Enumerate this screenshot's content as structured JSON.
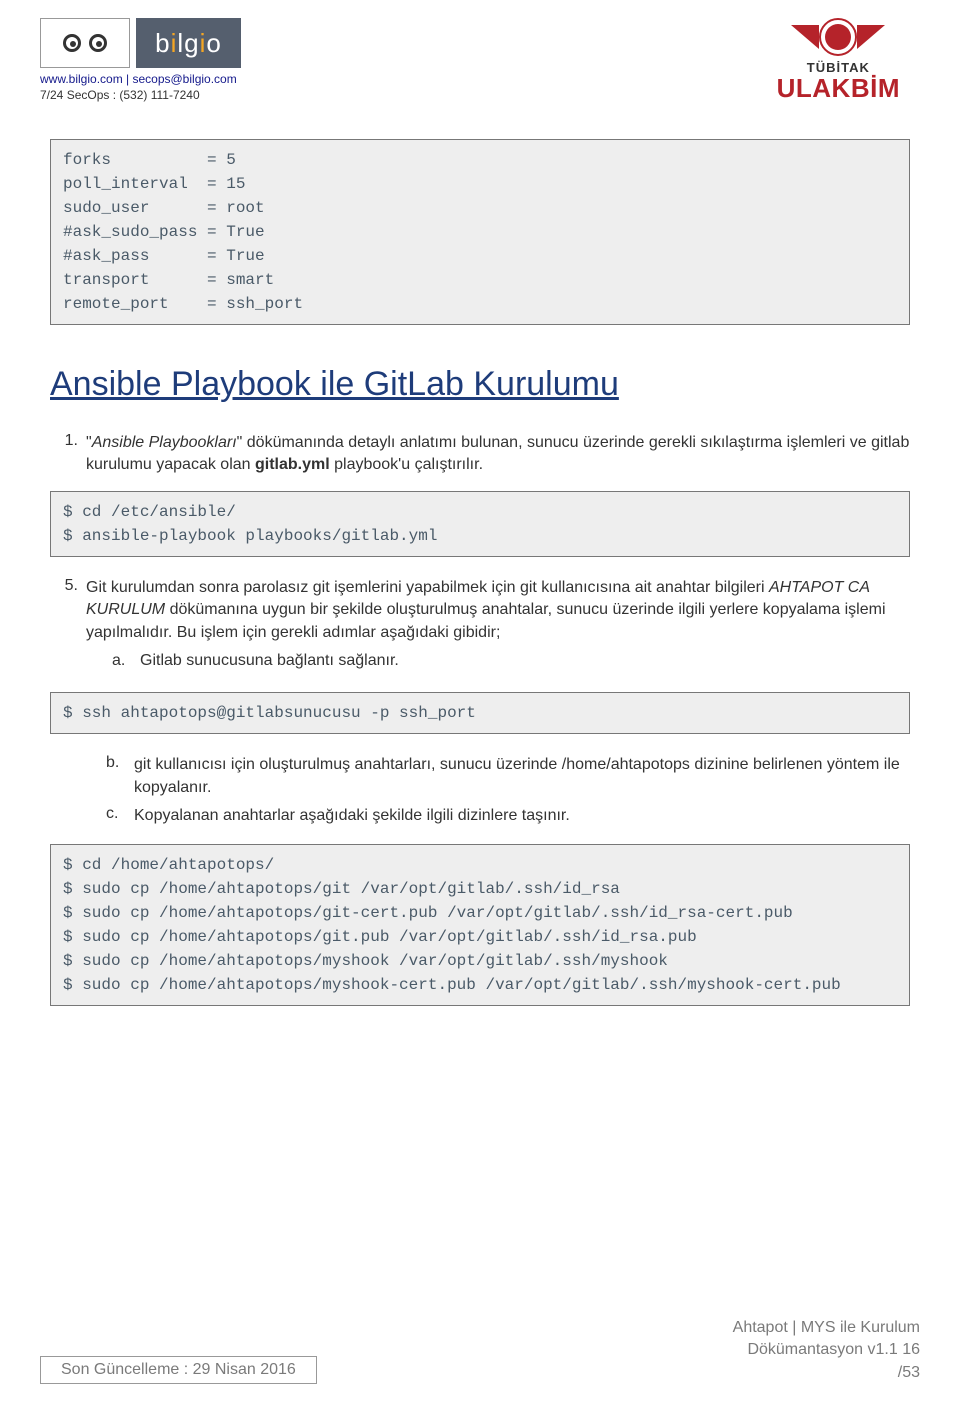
{
  "header": {
    "brand": "bilgio",
    "contact1": "www.bilgio.com | secops@bilgio.com",
    "contact2": "7/24 SecOps : (532) 111-7240",
    "tubitak": "TÜBİTAK",
    "ulakbim": "ULAKBİM"
  },
  "code1": "forks          = 5\npoll_interval  = 15\nsudo_user      = root\n#ask_sudo_pass = True\n#ask_pass      = True\ntransport      = smart\nremote_port    = ssh_port",
  "title": "Ansible Playbook ile GitLab Kurulumu",
  "item1": {
    "num": "1.",
    "pre": "\"",
    "italic": "Ansible Playbookları",
    "post": "\" dökümanında detaylı anlatımı bulunan, sunucu üzerinde gerekli sıkılaştırma işlemleri ve gitlab kurulumu yapacak olan ",
    "bold": "gitlab.yml",
    "tail": " playbook'u çalıştırılır."
  },
  "code2": "$ cd /etc/ansible/\n$ ansible-playbook playbooks/gitlab.yml",
  "item5": {
    "num": "5.",
    "pre": "Git kurulumdan sonra parolasız git işemlerini yapabilmek için git kullanıcısına ait anahtar bilgileri ",
    "italic": "AHTAPOT CA KURULUM",
    "post": " dökümanına uygun bir şekilde oluşturulmuş anahtalar, sunucu üzerinde ilgili yerlere kopyalama işlemi yapılmalıdır. Bu işlem için gerekli adımlar aşağıdaki gibidir;"
  },
  "sub_a": {
    "letter": "a.",
    "text": "Gitlab sunucusuna bağlantı sağlanır."
  },
  "code3": "$ ssh ahtapotops@gitlabsunucusu -p ssh_port",
  "sub_b": {
    "letter": "b.",
    "text": "git kullanıcısı için oluşturulmuş anahtarları, sunucu üzerinde /home/ahtapotops dizinine belirlenen yöntem ile kopyalanır."
  },
  "sub_c": {
    "letter": "c.",
    "text": "Kopyalanan anahtarlar aşağıdaki şekilde ilgili dizinlere taşınır."
  },
  "code4": "$ cd /home/ahtapotops/\n$ sudo cp /home/ahtapotops/git /var/opt/gitlab/.ssh/id_rsa\n$ sudo cp /home/ahtapotops/git-cert.pub /var/opt/gitlab/.ssh/id_rsa-cert.pub\n$ sudo cp /home/ahtapotops/git.pub /var/opt/gitlab/.ssh/id_rsa.pub\n$ sudo cp /home/ahtapotops/myshook /var/opt/gitlab/.ssh/myshook\n$ sudo cp /home/ahtapotops/myshook-cert.pub /var/opt/gitlab/.ssh/myshook-cert.pub",
  "footer": {
    "left": "Son Güncelleme : 29 Nisan 2016",
    "r1": "Ahtapot | MYS ile Kurulum",
    "r2": "Dökümantasyon v1.1 16",
    "r3": "/53"
  }
}
